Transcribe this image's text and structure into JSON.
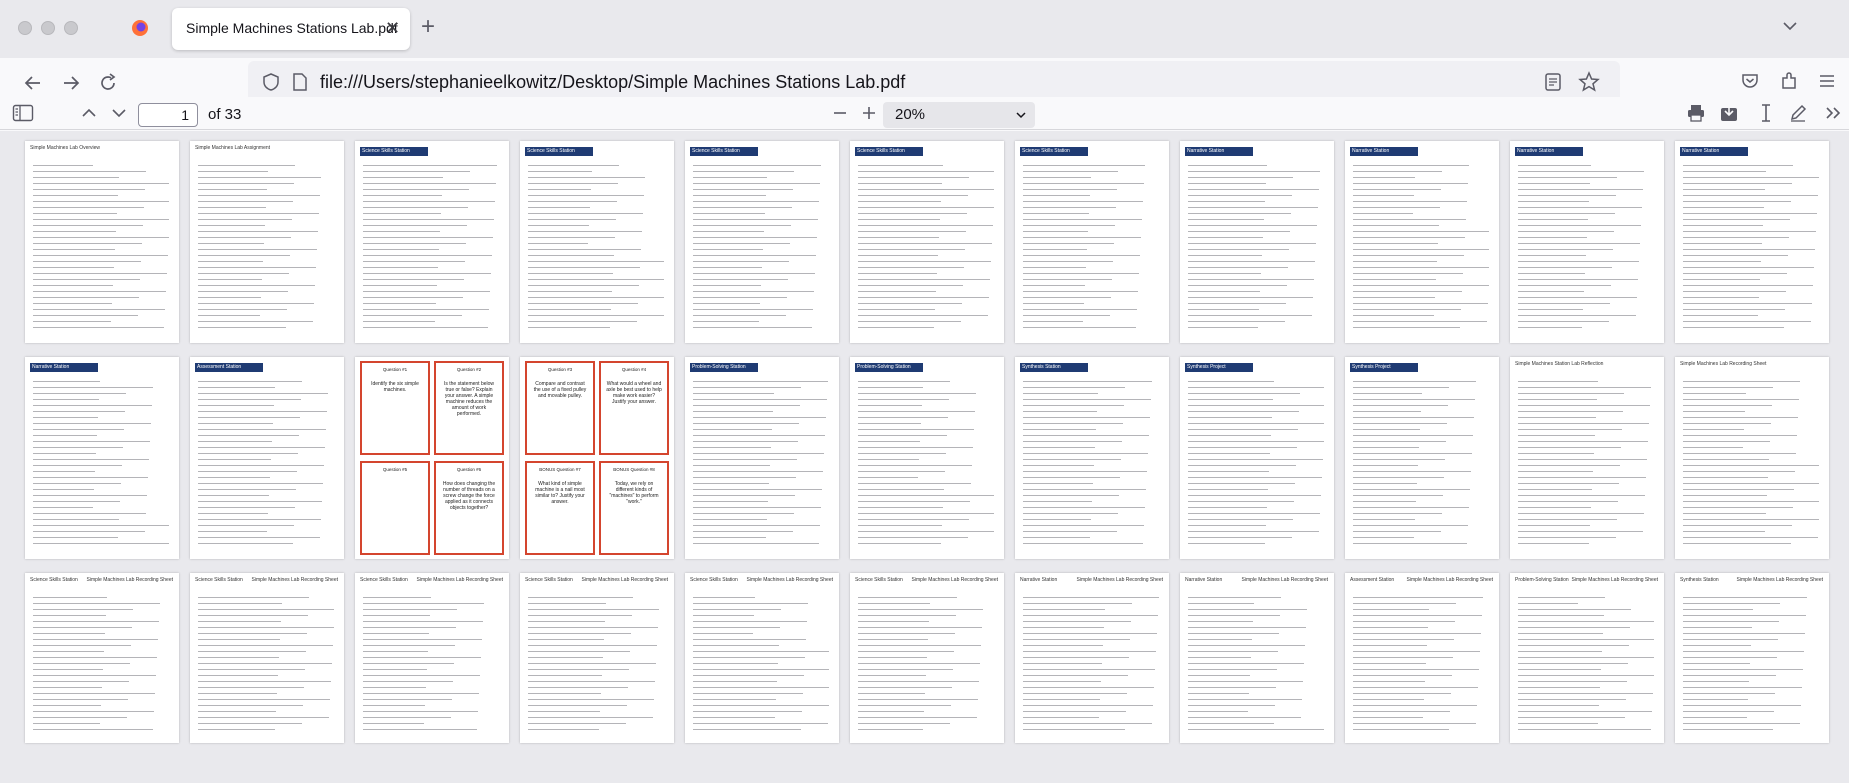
{
  "browser": {
    "tab_title": "Simple Machines Stations Lab.pdf",
    "tab_close_glyph": "✕",
    "new_tab_glyph": "+",
    "url": "file:///Users/stephanieelkowitz/Desktop/Simple Machines Stations Lab.pdf"
  },
  "pdf_toolbar": {
    "page_number": "1",
    "page_count": "of 33",
    "zoom": "20%"
  },
  "thumbnails": {
    "row1": [
      {
        "kind": "doc",
        "label": "Simple Machines Lab Overview"
      },
      {
        "kind": "doc",
        "label": "Simple Machines Lab Assignment"
      },
      {
        "kind": "station",
        "header": "Science Skills Station"
      },
      {
        "kind": "station",
        "header": "Science Skills Station"
      },
      {
        "kind": "station",
        "header": "Science Skills Station"
      },
      {
        "kind": "station",
        "header": "Science Skills Station"
      },
      {
        "kind": "station",
        "header": "Science Skills Station"
      },
      {
        "kind": "station",
        "header": "Narrative Station"
      },
      {
        "kind": "station",
        "header": "Narrative Station"
      },
      {
        "kind": "station",
        "header": "Narrative Station"
      },
      {
        "kind": "station",
        "header": "Narrative Station"
      }
    ],
    "row2": [
      {
        "kind": "station",
        "header": "Narrative Station"
      },
      {
        "kind": "station",
        "header": "Assessment Station"
      },
      {
        "kind": "cards",
        "titles": [
          "Question #1",
          "Question #2"
        ],
        "bodies": [
          "Identify the six simple machines.",
          "Is the statement below true or false? Explain your answer. A simple machine reduces the amount of work performed."
        ]
      },
      {
        "kind": "cards",
        "titles": [
          "Question #3",
          "Question #4"
        ],
        "bodies": [
          "Compare and contrast the use of a fixed pulley and movable pulley.",
          "What would a wheel and axle be best used to help make work easier? Justify your answer."
        ]
      },
      {
        "kind": "station",
        "header": "Problem-Solving Station"
      },
      {
        "kind": "station",
        "header": "Problem-Solving Station"
      },
      {
        "kind": "station",
        "header": "Synthesis Station"
      },
      {
        "kind": "station",
        "header": "Synthesis Project"
      },
      {
        "kind": "station",
        "header": "Synthesis Project"
      },
      {
        "kind": "doc",
        "label": "Simple Machines Station Lab Reflection"
      },
      {
        "kind": "doc",
        "label": "Simple Machines Lab Recording Sheet"
      }
    ],
    "row2_cards_lower": [
      {
        "titles": [
          "Question #5",
          "Question #6"
        ],
        "bodies": [
          "",
          "How does changing the number of threads on a screw change the force applied as it connects objects together?"
        ]
      },
      {
        "titles": [
          "BONUS Question #7",
          "BONUS Question #8"
        ],
        "bodies": [
          "What kind of simple machine is a nail most similar to? Justify your answer.",
          "Today, we rely on different kinds of \"machines\" to perform \"work.\""
        ]
      }
    ],
    "row3": [
      {
        "label": "Science Skills Station",
        "right": "Simple Machines Lab Recording Sheet"
      },
      {
        "label": "Science Skills Station",
        "right": "Simple Machines Lab Recording Sheet"
      },
      {
        "label": "Science Skills Station",
        "right": "Simple Machines Lab Recording Sheet"
      },
      {
        "label": "Science Skills Station",
        "right": "Simple Machines Lab Recording Sheet"
      },
      {
        "label": "Science Skills Station",
        "right": "Simple Machines Lab Recording Sheet"
      },
      {
        "label": "Science Skills Station",
        "right": "Simple Machines Lab Recording Sheet"
      },
      {
        "label": "Narrative Station",
        "right": "Simple Machines Lab Recording Sheet"
      },
      {
        "label": "Narrative Station",
        "right": "Simple Machines Lab Recording Sheet"
      },
      {
        "label": "Assessment Station",
        "right": "Simple Machines Lab Recording Sheet"
      },
      {
        "label": "Problem-Solving Station",
        "right": "Simple Machines Lab Recording Sheet"
      },
      {
        "label": "Synthesis Station",
        "right": "Simple Machines Lab Recording Sheet"
      }
    ]
  },
  "colors": {
    "header_navy": "#1f3b73",
    "card_red": "#d4452e",
    "firefox_orange": "#ff7139"
  }
}
